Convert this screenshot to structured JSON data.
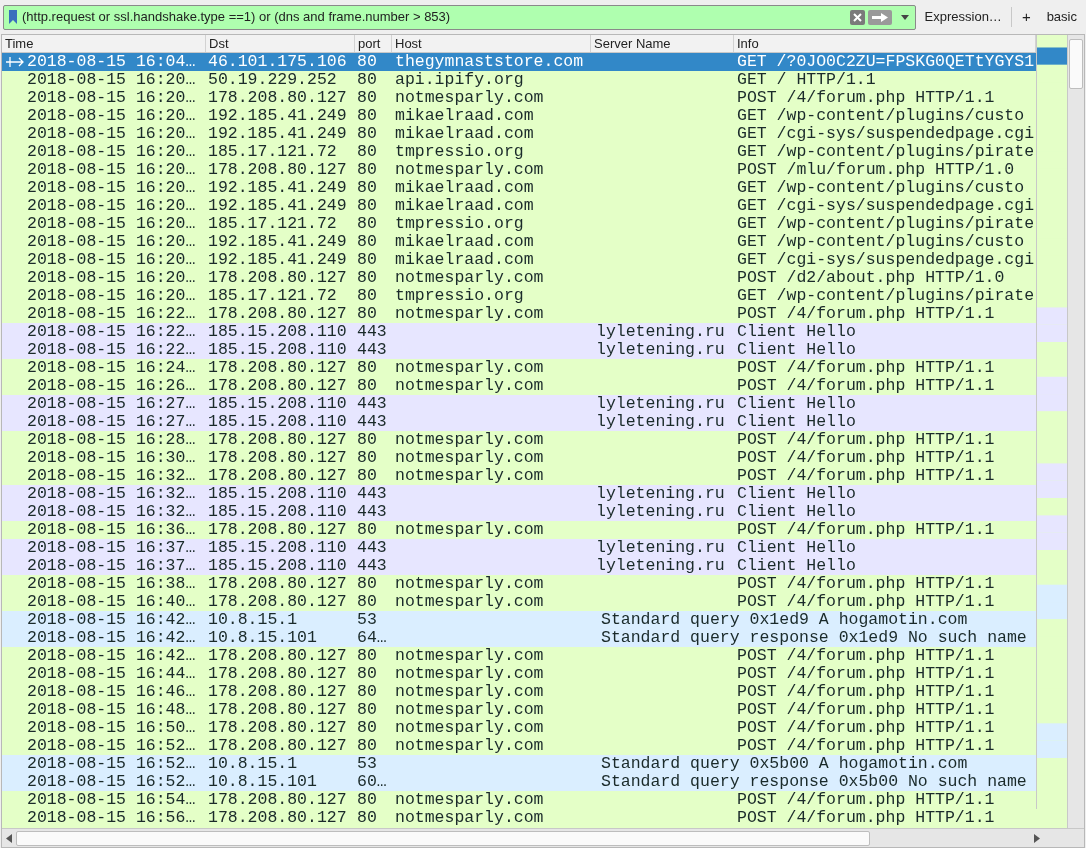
{
  "filter_bar": {
    "value": "(http.request or ssl.handshake.type ==1) or (dns and frame.number > 853)",
    "expression_button": "Expression…",
    "add_button": "+",
    "label_button": "basic"
  },
  "table": {
    "columns": [
      "Time",
      "Dst",
      "port",
      "Host",
      "Server Name",
      "Info"
    ],
    "rows": [
      {
        "kind": "http",
        "selected": true,
        "time": "2018-08-15 16:04…",
        "dst": "46.101.175.106",
        "port": "80",
        "host": "thegymnaststore.com",
        "info": "GET /?0JO0C2ZU=FPSKG0QETtYGYS1"
      },
      {
        "kind": "http",
        "selected": false,
        "time": "2018-08-15 16:20…",
        "dst": "50.19.229.252",
        "port": "80",
        "host": "api.ipify.org",
        "info": "GET / HTTP/1.1"
      },
      {
        "kind": "http",
        "selected": false,
        "time": "2018-08-15 16:20…",
        "dst": "178.208.80.127",
        "port": "80",
        "host": "notmesparly.com",
        "info": "POST /4/forum.php HTTP/1.1"
      },
      {
        "kind": "http",
        "selected": false,
        "time": "2018-08-15 16:20…",
        "dst": "192.185.41.249",
        "port": "80",
        "host": "mikaelraad.com",
        "info": "GET /wp-content/plugins/custo"
      },
      {
        "kind": "http",
        "selected": false,
        "time": "2018-08-15 16:20…",
        "dst": "192.185.41.249",
        "port": "80",
        "host": "mikaelraad.com",
        "info": "GET /cgi-sys/suspendedpage.cgi"
      },
      {
        "kind": "http",
        "selected": false,
        "time": "2018-08-15 16:20…",
        "dst": "185.17.121.72",
        "port": "80",
        "host": "tmpressio.org",
        "info": "GET /wp-content/plugins/pirate"
      },
      {
        "kind": "http",
        "selected": false,
        "time": "2018-08-15 16:20…",
        "dst": "178.208.80.127",
        "port": "80",
        "host": "notmesparly.com",
        "info": "POST /mlu/forum.php HTTP/1.0"
      },
      {
        "kind": "http",
        "selected": false,
        "time": "2018-08-15 16:20…",
        "dst": "192.185.41.249",
        "port": "80",
        "host": "mikaelraad.com",
        "info": "GET /wp-content/plugins/custo"
      },
      {
        "kind": "http",
        "selected": false,
        "time": "2018-08-15 16:20…",
        "dst": "192.185.41.249",
        "port": "80",
        "host": "mikaelraad.com",
        "info": "GET /cgi-sys/suspendedpage.cgi"
      },
      {
        "kind": "http",
        "selected": false,
        "time": "2018-08-15 16:20…",
        "dst": "185.17.121.72",
        "port": "80",
        "host": "tmpressio.org",
        "info": "GET /wp-content/plugins/pirate"
      },
      {
        "kind": "http",
        "selected": false,
        "time": "2018-08-15 16:20…",
        "dst": "192.185.41.249",
        "port": "80",
        "host": "mikaelraad.com",
        "info": "GET /wp-content/plugins/custo"
      },
      {
        "kind": "http",
        "selected": false,
        "time": "2018-08-15 16:20…",
        "dst": "192.185.41.249",
        "port": "80",
        "host": "mikaelraad.com",
        "info": "GET /cgi-sys/suspendedpage.cgi"
      },
      {
        "kind": "http",
        "selected": false,
        "time": "2018-08-15 16:20…",
        "dst": "178.208.80.127",
        "port": "80",
        "host": "notmesparly.com",
        "info": "POST /d2/about.php HTTP/1.0"
      },
      {
        "kind": "http",
        "selected": false,
        "time": "2018-08-15 16:20…",
        "dst": "185.17.121.72",
        "port": "80",
        "host": "tmpressio.org",
        "info": "GET /wp-content/plugins/pirate"
      },
      {
        "kind": "http",
        "selected": false,
        "time": "2018-08-15 16:22…",
        "dst": "178.208.80.127",
        "port": "80",
        "host": "notmesparly.com",
        "info": "POST /4/forum.php HTTP/1.1"
      },
      {
        "kind": "tls",
        "selected": false,
        "time": "2018-08-15 16:22…",
        "dst": "185.15.208.110",
        "port": "443",
        "server_name": "lyletening.ru",
        "info": "Client Hello"
      },
      {
        "kind": "tls",
        "selected": false,
        "time": "2018-08-15 16:22…",
        "dst": "185.15.208.110",
        "port": "443",
        "server_name": "lyletening.ru",
        "info": "Client Hello"
      },
      {
        "kind": "http",
        "selected": false,
        "time": "2018-08-15 16:24…",
        "dst": "178.208.80.127",
        "port": "80",
        "host": "notmesparly.com",
        "info": "POST /4/forum.php HTTP/1.1"
      },
      {
        "kind": "http",
        "selected": false,
        "time": "2018-08-15 16:26…",
        "dst": "178.208.80.127",
        "port": "80",
        "host": "notmesparly.com",
        "info": "POST /4/forum.php HTTP/1.1"
      },
      {
        "kind": "tls",
        "selected": false,
        "time": "2018-08-15 16:27…",
        "dst": "185.15.208.110",
        "port": "443",
        "server_name": "lyletening.ru",
        "info": "Client Hello"
      },
      {
        "kind": "tls",
        "selected": false,
        "time": "2018-08-15 16:27…",
        "dst": "185.15.208.110",
        "port": "443",
        "server_name": "lyletening.ru",
        "info": "Client Hello"
      },
      {
        "kind": "http",
        "selected": false,
        "time": "2018-08-15 16:28…",
        "dst": "178.208.80.127",
        "port": "80",
        "host": "notmesparly.com",
        "info": "POST /4/forum.php HTTP/1.1"
      },
      {
        "kind": "http",
        "selected": false,
        "time": "2018-08-15 16:30…",
        "dst": "178.208.80.127",
        "port": "80",
        "host": "notmesparly.com",
        "info": "POST /4/forum.php HTTP/1.1"
      },
      {
        "kind": "http",
        "selected": false,
        "time": "2018-08-15 16:32…",
        "dst": "178.208.80.127",
        "port": "80",
        "host": "notmesparly.com",
        "info": "POST /4/forum.php HTTP/1.1"
      },
      {
        "kind": "tls",
        "selected": false,
        "time": "2018-08-15 16:32…",
        "dst": "185.15.208.110",
        "port": "443",
        "server_name": "lyletening.ru",
        "info": "Client Hello"
      },
      {
        "kind": "tls",
        "selected": false,
        "time": "2018-08-15 16:32…",
        "dst": "185.15.208.110",
        "port": "443",
        "server_name": "lyletening.ru",
        "info": "Client Hello"
      },
      {
        "kind": "http",
        "selected": false,
        "time": "2018-08-15 16:36…",
        "dst": "178.208.80.127",
        "port": "80",
        "host": "notmesparly.com",
        "info": "POST /4/forum.php HTTP/1.1"
      },
      {
        "kind": "tls",
        "selected": false,
        "time": "2018-08-15 16:37…",
        "dst": "185.15.208.110",
        "port": "443",
        "server_name": "lyletening.ru",
        "info": "Client Hello"
      },
      {
        "kind": "tls",
        "selected": false,
        "time": "2018-08-15 16:37…",
        "dst": "185.15.208.110",
        "port": "443",
        "server_name": "lyletening.ru",
        "info": "Client Hello"
      },
      {
        "kind": "http",
        "selected": false,
        "time": "2018-08-15 16:38…",
        "dst": "178.208.80.127",
        "port": "80",
        "host": "notmesparly.com",
        "info": "POST /4/forum.php HTTP/1.1"
      },
      {
        "kind": "http",
        "selected": false,
        "time": "2018-08-15 16:40…",
        "dst": "178.208.80.127",
        "port": "80",
        "host": "notmesparly.com",
        "info": "POST /4/forum.php HTTP/1.1"
      },
      {
        "kind": "dns",
        "selected": false,
        "time": "2018-08-15 16:42…",
        "dst": "10.8.15.1",
        "port": "53",
        "info": "Standard query 0x1ed9 A hogamotin.com"
      },
      {
        "kind": "dns",
        "selected": false,
        "time": "2018-08-15 16:42…",
        "dst": "10.8.15.101",
        "port": "64…",
        "info": "Standard query response 0x1ed9 No such name"
      },
      {
        "kind": "http",
        "selected": false,
        "time": "2018-08-15 16:42…",
        "dst": "178.208.80.127",
        "port": "80",
        "host": "notmesparly.com",
        "info": "POST /4/forum.php HTTP/1.1"
      },
      {
        "kind": "http",
        "selected": false,
        "time": "2018-08-15 16:44…",
        "dst": "178.208.80.127",
        "port": "80",
        "host": "notmesparly.com",
        "info": "POST /4/forum.php HTTP/1.1"
      },
      {
        "kind": "http",
        "selected": false,
        "time": "2018-08-15 16:46…",
        "dst": "178.208.80.127",
        "port": "80",
        "host": "notmesparly.com",
        "info": "POST /4/forum.php HTTP/1.1"
      },
      {
        "kind": "http",
        "selected": false,
        "time": "2018-08-15 16:48…",
        "dst": "178.208.80.127",
        "port": "80",
        "host": "notmesparly.com",
        "info": "POST /4/forum.php HTTP/1.1"
      },
      {
        "kind": "http",
        "selected": false,
        "time": "2018-08-15 16:50…",
        "dst": "178.208.80.127",
        "port": "80",
        "host": "notmesparly.com",
        "info": "POST /4/forum.php HTTP/1.1"
      },
      {
        "kind": "http",
        "selected": false,
        "time": "2018-08-15 16:52…",
        "dst": "178.208.80.127",
        "port": "80",
        "host": "notmesparly.com",
        "info": "POST /4/forum.php HTTP/1.1"
      },
      {
        "kind": "dns",
        "selected": false,
        "time": "2018-08-15 16:52…",
        "dst": "10.8.15.1",
        "port": "53",
        "info": "Standard query 0x5b00 A hogamotin.com"
      },
      {
        "kind": "dns",
        "selected": false,
        "time": "2018-08-15 16:52…",
        "dst": "10.8.15.101",
        "port": "60…",
        "info": "Standard query response 0x5b00 No such name"
      },
      {
        "kind": "http",
        "selected": false,
        "time": "2018-08-15 16:54…",
        "dst": "178.208.80.127",
        "port": "80",
        "host": "notmesparly.com",
        "info": "POST /4/forum.php HTTP/1.1"
      },
      {
        "kind": "http",
        "selected": false,
        "time": "2018-08-15 16:56…",
        "dst": "178.208.80.127",
        "port": "80",
        "host": "notmesparly.com",
        "info": "POST /4/forum.php HTTP/1.1"
      }
    ]
  }
}
